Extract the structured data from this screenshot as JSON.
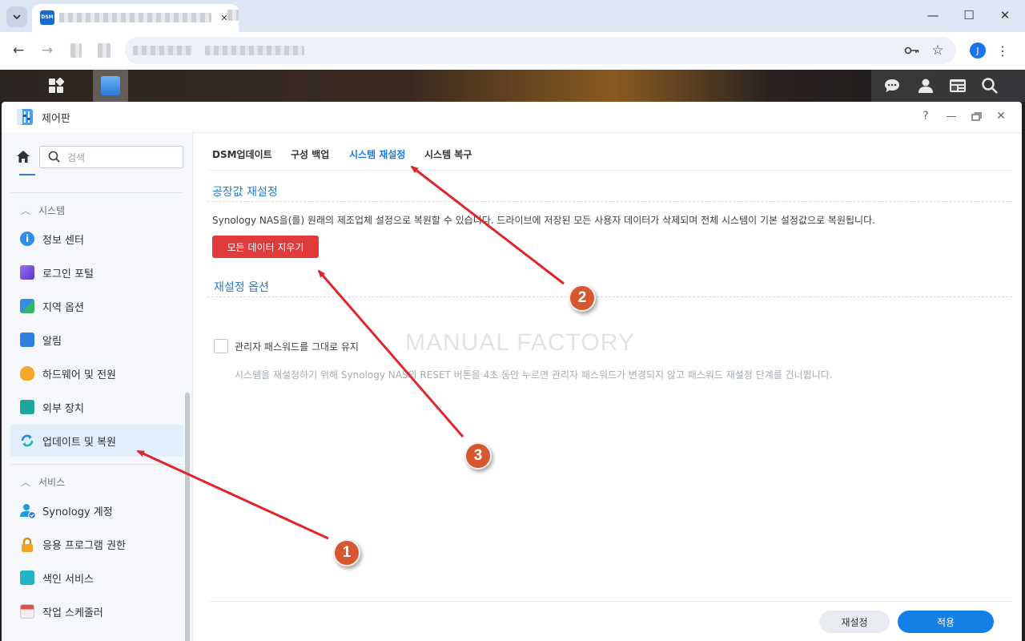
{
  "browser": {
    "avatar_initial": "J"
  },
  "window": {
    "title": "제어판",
    "help_glyph": "?"
  },
  "sidebar": {
    "search_placeholder": "검색",
    "sections": [
      {
        "label": "시스템"
      },
      {
        "label": "서비스"
      }
    ],
    "items": [
      {
        "label": "정보 센터",
        "icon": "info-icon",
        "color": "#2f8fe8"
      },
      {
        "label": "로그인 포털",
        "icon": "login-portal-icon",
        "color": "#7a4ed6"
      },
      {
        "label": "지역 옵션",
        "icon": "region-icon",
        "color": "#2fa86b"
      },
      {
        "label": "알림",
        "icon": "notification-icon",
        "color": "#2f7fe0"
      },
      {
        "label": "하드웨어 및 전원",
        "icon": "bulb-icon",
        "color": "#f3a72b"
      },
      {
        "label": "외부 장치",
        "icon": "external-device-icon",
        "color": "#1ea89a"
      },
      {
        "label": "업데이트 및 복원",
        "icon": "update-restore-icon",
        "color": "#1f8fd9"
      },
      {
        "label": "Synology 계정",
        "icon": "synology-account-icon",
        "color": "#1f9ce0"
      },
      {
        "label": "응용 프로그램 권한",
        "icon": "lock-icon",
        "color": "#f1a51f"
      },
      {
        "label": "색인 서비스",
        "icon": "index-service-icon",
        "color": "#22b3c6"
      },
      {
        "label": "작업 스케줄러",
        "icon": "calendar-icon",
        "color": "#e44d4d"
      }
    ]
  },
  "content": {
    "tabs": [
      {
        "label": "DSM업데이트"
      },
      {
        "label": "구성 백업"
      },
      {
        "label": "시스템 재설정"
      },
      {
        "label": "시스템 복구"
      }
    ],
    "factory_reset": {
      "title": "공장값 재설정",
      "description": "Synology NAS을(를) 원래의 제조업체 설정으로 복원할 수 있습니다. 드라이브에 저장된 모든 사용자 데이터가 삭제되며 전체 시스템이 기본 설정값으로 복원됩니다.",
      "button": "모든 데이터 지우기"
    },
    "reset_options": {
      "title": "재설정 옵션",
      "checkbox_label": "관리자 패스워드를 그대로 유지",
      "hint": "시스템을 재설정하기 위해 Synology NAS의 RESET 버튼을 4초 동안 누르면 관리자 패스워드가 변경되지 않고 패스워드 재설정 단계를 건너뜁니다."
    },
    "watermark": "MANUAL FACTORY"
  },
  "footer": {
    "reset_button": "재설정",
    "apply_button": "적용"
  },
  "annotations": {
    "badges": [
      "1",
      "2",
      "3"
    ],
    "color": "#e0262b"
  }
}
